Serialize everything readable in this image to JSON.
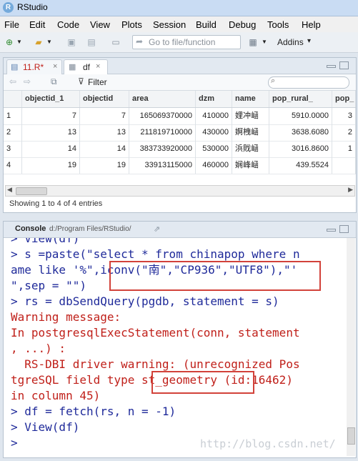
{
  "app": {
    "title": "RStudio",
    "logo": "R"
  },
  "menu": [
    "File",
    "Edit",
    "Code",
    "View",
    "Plots",
    "Session",
    "Build",
    "Debug",
    "Tools",
    "Help"
  ],
  "toolbar": {
    "goto_placeholder": "Go to file/function",
    "addins": "Addins"
  },
  "tabs": [
    {
      "label": "11.R*",
      "color": "#c0201a"
    },
    {
      "label": "df"
    }
  ],
  "viewer": {
    "filter_label": "Filter"
  },
  "table": {
    "columns": [
      "",
      "objectid_1",
      "objectid",
      "area",
      "dzm",
      "name",
      "pop_rural_",
      "pop_"
    ],
    "rows": [
      [
        "1",
        "7",
        "7",
        "165069370000",
        "410000",
        "娌冲崡",
        "5910.0000",
        "3"
      ],
      [
        "2",
        "13",
        "13",
        "211819710000",
        "430000",
        "婀栧崡",
        "3638.6080",
        "2"
      ],
      [
        "3",
        "14",
        "14",
        "383733920000",
        "530000",
        "浜戝崡",
        "3016.8600",
        "1"
      ],
      [
        "4",
        "19",
        "19",
        "33913115000",
        "460000",
        "娴峰崡",
        "439.5524",
        ""
      ]
    ],
    "status": "Showing 1 to 4 of 4 entries"
  },
  "console": {
    "label": "Console",
    "path": "d:/Program Files/RStudio/",
    "lines": [
      {
        "text": "> View(df)",
        "cls": "blue"
      },
      {
        "text": "> s =paste(\"select * from chinapop where n",
        "cls": "blue"
      },
      {
        "text": "ame like '%\",iconv(\"南\",\"CP936\",\"UTF8\"),\"'",
        "cls": "blue"
      },
      {
        "text": "\",sep = \"\")",
        "cls": "blue"
      },
      {
        "text": "> rs = dbSendQuery(pgdb, statement = s)",
        "cls": "blue"
      },
      {
        "text": "Warning message:",
        "cls": "red"
      },
      {
        "text": "In postgresqlExecStatement(conn, statement",
        "cls": "red"
      },
      {
        "text": ", ...) :",
        "cls": "red"
      },
      {
        "text": "  RS-DBI driver warning: (unrecognized Pos",
        "cls": "red"
      },
      {
        "text": "tgreSQL field type st_geometry (id:16462)",
        "cls": "red"
      },
      {
        "text": "in column 45)",
        "cls": "red"
      },
      {
        "text": "> df = fetch(rs, n = -1)",
        "cls": "blue"
      },
      {
        "text": "> View(df)",
        "cls": "blue"
      },
      {
        "text": "> ",
        "cls": "blue"
      }
    ]
  },
  "watermark": "http://blog.csdn.net/"
}
